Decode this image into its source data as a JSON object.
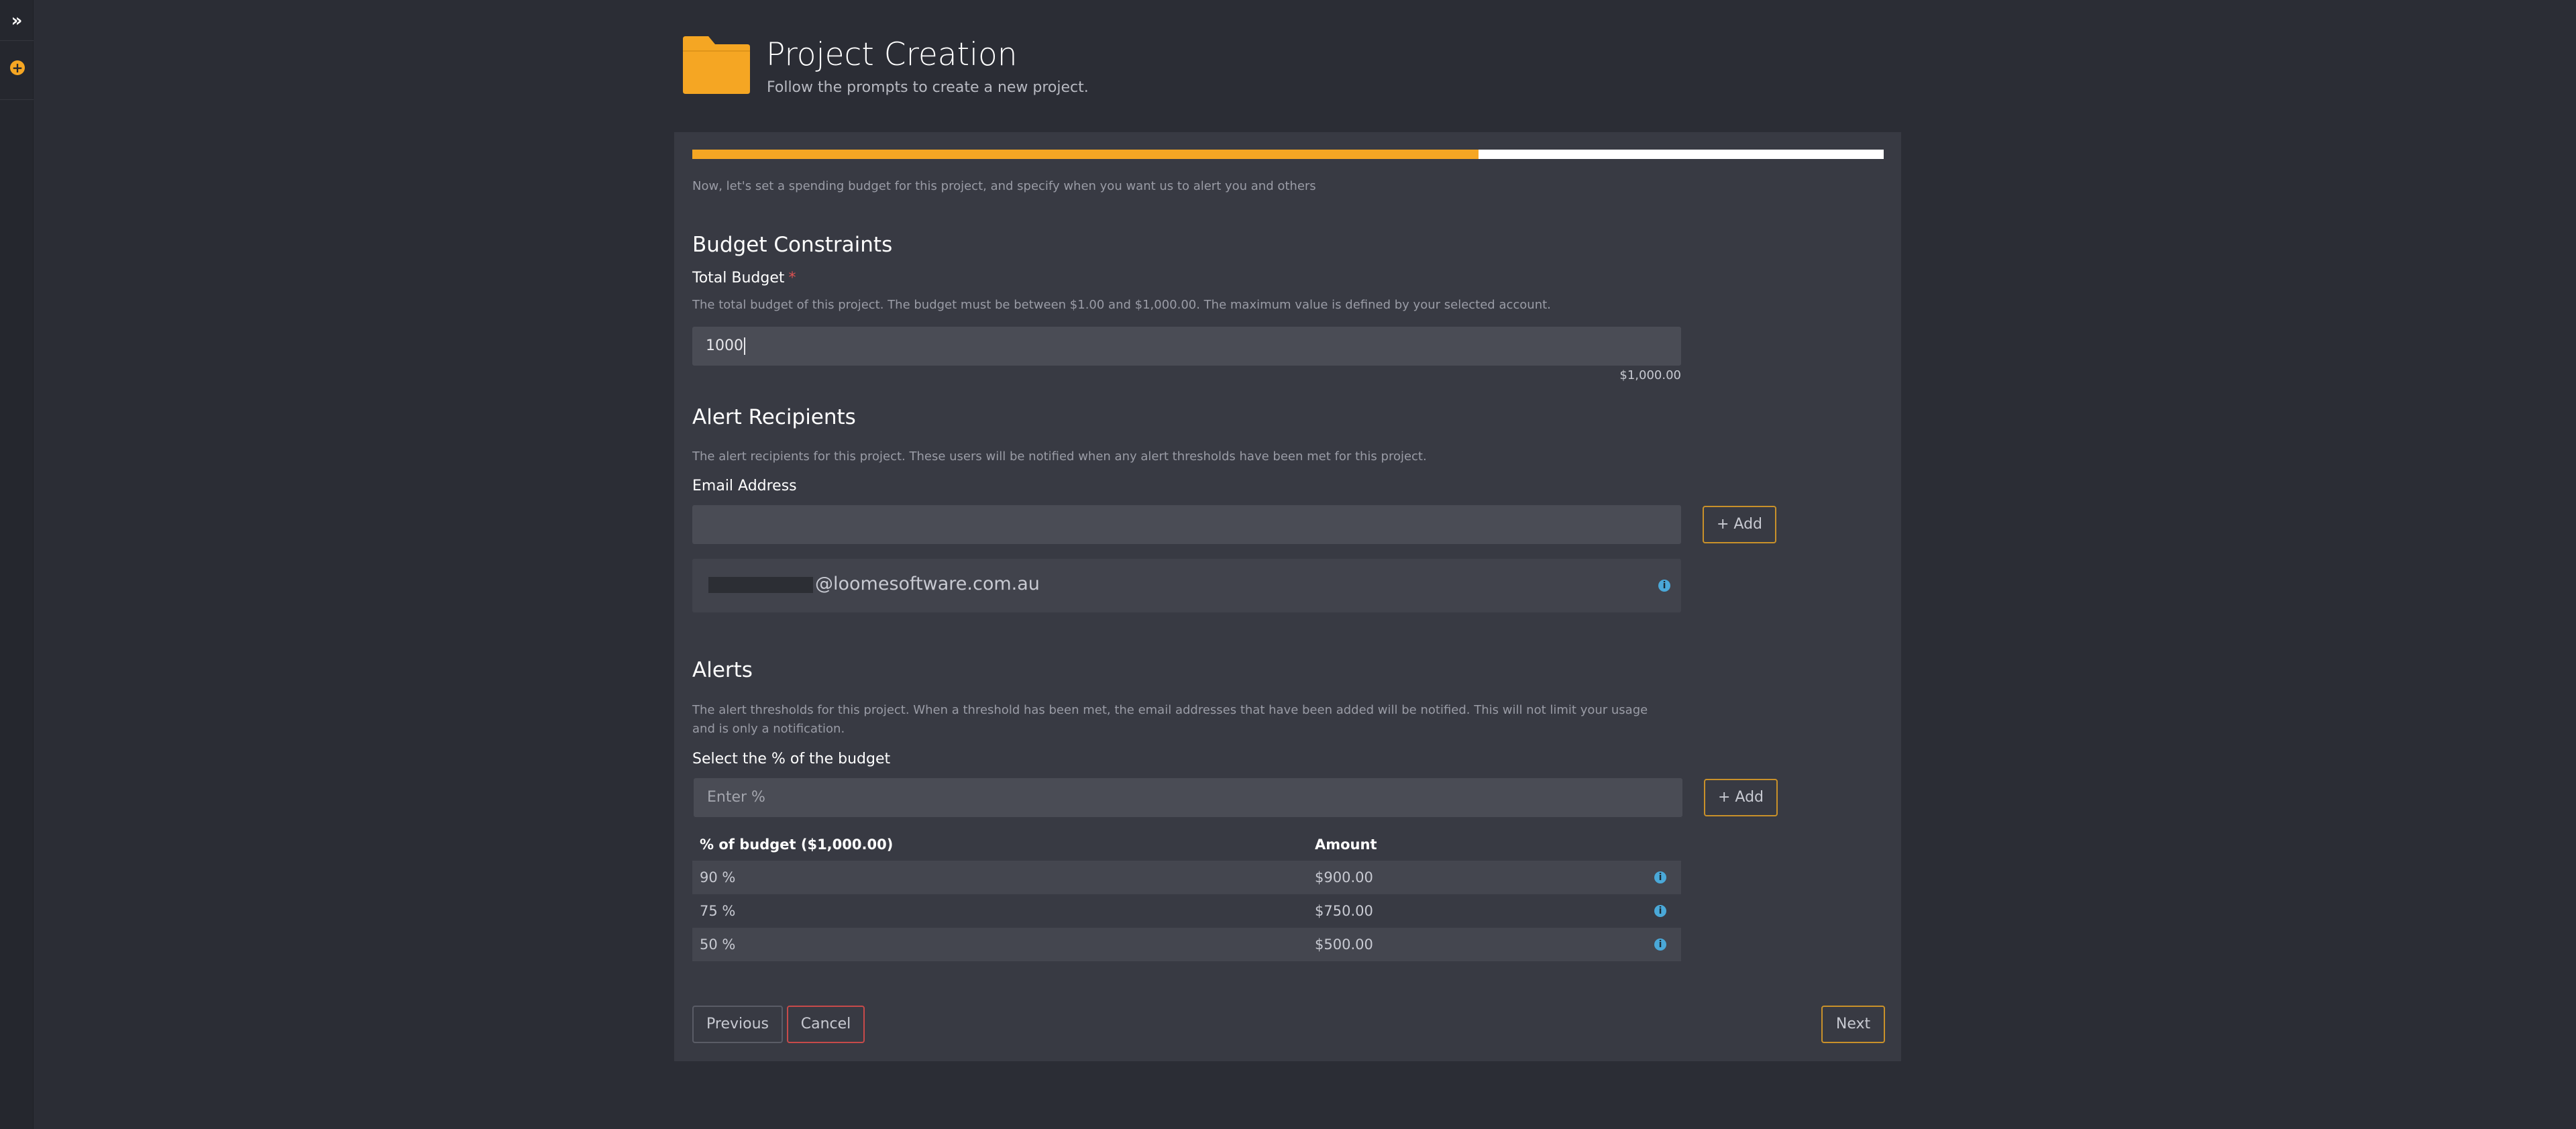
{
  "sidebar": {
    "expand_icon": "double-chevron-right-icon",
    "expand_glyph": "»",
    "add_icon": "plus-circle-icon",
    "add_glyph": "+"
  },
  "header": {
    "title": "Project Creation",
    "subtitle": "Follow the prompts to create a new project.",
    "icon": "folder-icon",
    "icon_color": "#f5a623"
  },
  "wizard": {
    "progress_percent": 66,
    "intro": "Now, let's set a spending budget for this project, and specify when you want us to alert you and others"
  },
  "budget": {
    "section_title": "Budget Constraints",
    "field_label": "Total Budget",
    "required_marker": "*",
    "help": "The total budget of this project. The budget must be between $1.00 and $1,000.00. The maximum value is defined by your selected account.",
    "value": "1000",
    "formatted": "$1,000.00"
  },
  "recipients": {
    "section_title": "Alert Recipients",
    "help": "The alert recipients for this project. These users will be notified when any alert thresholds have been met for this project.",
    "field_label": "Email Address",
    "input_value": "",
    "add_label": "+ Add",
    "list": [
      {
        "email_domain": "@loomesoftware.com.au"
      }
    ]
  },
  "alerts": {
    "section_title": "Alerts",
    "help": "The alert thresholds for this project. When a threshold has been met, the email addresses that have been added will be notified. This will not limit your usage and is only a notification.",
    "field_label": "Select the % of the budget",
    "placeholder": "Enter %",
    "add_label": "+ Add",
    "columns": [
      "% of budget ($1,000.00)",
      "Amount"
    ],
    "rows": [
      {
        "percent": "90 %",
        "amount": "$900.00"
      },
      {
        "percent": "75 %",
        "amount": "$750.00"
      },
      {
        "percent": "50 %",
        "amount": "$500.00"
      }
    ]
  },
  "footer": {
    "previous_label": "Previous",
    "cancel_label": "Cancel",
    "next_label": "Next"
  },
  "colors": {
    "accent": "#f5a623",
    "danger": "#c74a4a",
    "info": "#4aa8d8"
  }
}
